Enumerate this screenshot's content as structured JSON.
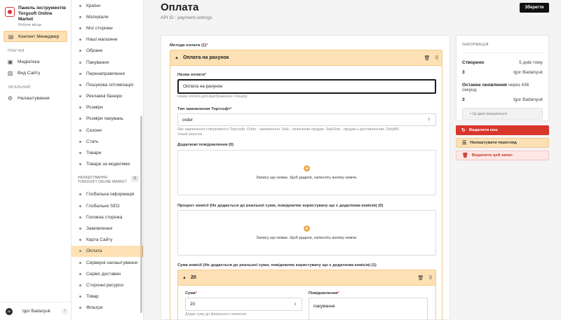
{
  "brand": {
    "title_line1": "Панель інструментів",
    "title_line2": "Torgsoft Online Market",
    "subtitle": "Робоче місце"
  },
  "nav": {
    "content_manager": "Контент Менеджер",
    "plugins_section": "ПЛАГІНИ",
    "media": "Медіатека",
    "site_view": "Вид Сайту",
    "general_section": "ЗАГАЛЬНИЙ",
    "settings": "Налаштування"
  },
  "user": {
    "name": "Igor Badanyuk",
    "initials": "IB",
    "collapse": "‹"
  },
  "subnav": {
    "items": [
      "Країни",
      "Матеріали",
      "Мої сторінки",
      "Наші магазини",
      "Обране",
      "Пакування",
      "Перенаправлення",
      "Пошукова оптимізація",
      "Рекламні банери",
      "Розміри",
      "Розміри пакувань",
      "Сезони",
      "Стать",
      "Товари",
      "Товари за моделями"
    ],
    "group_title_line1": "НАЛАШТУВАННЯ",
    "group_title_line2": "TORGSOFT ONLINE MARKET",
    "group_count": "11",
    "group_items": [
      "Глобальна інформація",
      "Глобальне SEO",
      "Головна сторінка",
      "Замовлення",
      "Карта Сайту",
      "Оплата",
      "Серверні налаштування",
      "Сервіс доставки",
      "Сторонні ресурси",
      "Товар",
      "Фільтри"
    ],
    "active": "Оплата"
  },
  "page": {
    "title": "Оплата",
    "api_id": "API ID : payment-settings",
    "save_label": "Зберегти"
  },
  "form": {
    "methods_label": "Методи оплати (1)",
    "method": {
      "title": "Оплата на рахунок",
      "name_label": "Назва оплати",
      "name_value": "Оплата на рахунок",
      "name_help": "Назва оплати для відображення і пошуку.",
      "type_label": "Тип замовлення Торгсофт",
      "type_value": "order",
      "type_help_line1": "Яке замовлення створювати в Торгсофт. Order - замовлення. Sale - оплачений продаж. SaleShip - продаж з доставленням. OnlyBill -",
      "type_help_line2": "тільки рахунок",
      "extra_label": "Додаткові повідомлення (0)",
      "empty_text": "Запису ще немає. Щоб додати, натисніть кнопку нижче.",
      "commission_label": "Процент комісії (Не додається до реальної суми, повідомляє користувачу що є додаткова комісія) (0)",
      "commission_sum_label": "Сума комісії (Не додається до реальної суми, повідомляє користувачу що є додаткова комісія) (1)",
      "commission_item": {
        "title": "20",
        "sum_label": "Сума",
        "sum_value": "20",
        "sum_help": "Додає суму до фінального значення",
        "message_label": "Повідомлення",
        "message_value": "пакування"
      }
    }
  },
  "info": {
    "heading": "ІНФОРМАЦІЯ",
    "created_label": "Створено",
    "created_value": "5 днів тому",
    "created_by_initial": "3",
    "created_by": "Igor Badanyuk",
    "updated_label": "Останнє оновлення",
    "updated_value": "через 436 секунд",
    "updated_by_initial": "3",
    "updated_by": "Igor Badanyuk",
    "cache_note": "• Ці дані кешуються."
  },
  "actions": {
    "delete_cache": "Видалити кеш",
    "configure_view": "Налаштувати перегляд",
    "delete_entry": "Видалити цей запис"
  },
  "colors": {
    "accent": "#fde1b5",
    "danger": "#d8362a",
    "dark": "#111111"
  }
}
